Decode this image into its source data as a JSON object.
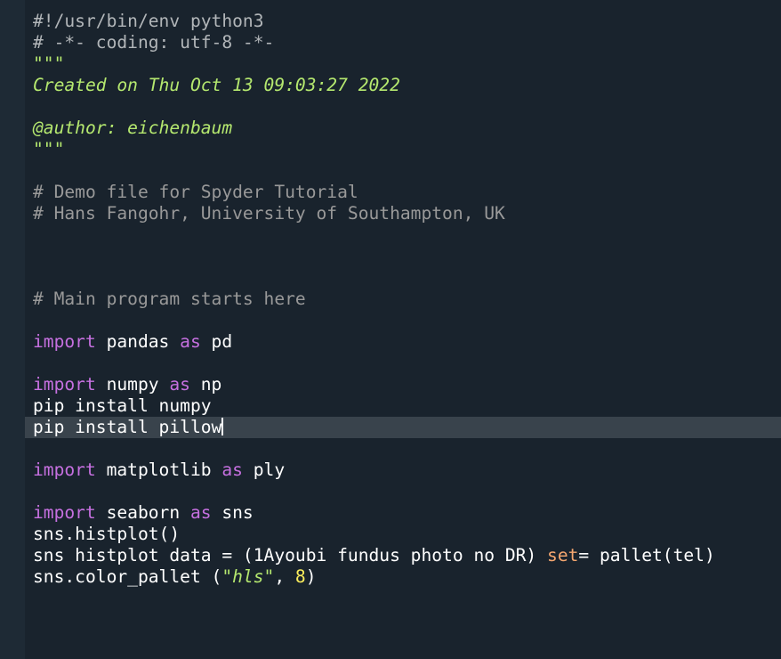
{
  "colors": {
    "background": "#19232d",
    "gutter": "#1e2a35",
    "current_line": "#39434c",
    "keyword": "#c670e0",
    "docstring": "#b5e86f",
    "comment": "#999999",
    "builtin": "#f5a770",
    "number": "#faed5c",
    "text": "#ffffff"
  },
  "editor": {
    "lines": [
      {
        "tokens": [
          {
            "t": "shebang",
            "v": "#!/usr/bin/env python3"
          }
        ]
      },
      {
        "tokens": [
          {
            "t": "shebang",
            "v": "# -*- coding: utf-8 -*-"
          }
        ]
      },
      {
        "tokens": [
          {
            "t": "docstring",
            "v": "\"\"\""
          }
        ]
      },
      {
        "tokens": [
          {
            "t": "docstring",
            "v": "Created on Thu Oct 13 09:03:27 2022"
          }
        ]
      },
      {
        "tokens": []
      },
      {
        "tokens": [
          {
            "t": "docstring",
            "v": "@author: eichenbaum"
          }
        ]
      },
      {
        "tokens": [
          {
            "t": "docstring",
            "v": "\"\"\""
          }
        ]
      },
      {
        "tokens": []
      },
      {
        "tokens": [
          {
            "t": "comment",
            "v": "# Demo file for Spyder Tutorial"
          }
        ]
      },
      {
        "tokens": [
          {
            "t": "comment",
            "v": "# Hans Fangohr, University of Southampton, UK"
          }
        ]
      },
      {
        "tokens": []
      },
      {
        "tokens": []
      },
      {
        "tokens": []
      },
      {
        "tokens": [
          {
            "t": "comment",
            "v": "# Main program starts here"
          }
        ]
      },
      {
        "tokens": []
      },
      {
        "tokens": [
          {
            "t": "kw",
            "v": "import"
          },
          {
            "t": "plain",
            "v": " pandas "
          },
          {
            "t": "kw",
            "v": "as"
          },
          {
            "t": "plain",
            "v": " pd"
          }
        ]
      },
      {
        "tokens": []
      },
      {
        "tokens": [
          {
            "t": "kw",
            "v": "import"
          },
          {
            "t": "plain",
            "v": " numpy "
          },
          {
            "t": "kw",
            "v": "as"
          },
          {
            "t": "plain",
            "v": " np"
          }
        ]
      },
      {
        "tokens": [
          {
            "t": "plain",
            "v": "pip install numpy"
          }
        ]
      },
      {
        "tokens": [
          {
            "t": "plain",
            "v": "pip install pillow"
          }
        ],
        "current": true
      },
      {
        "tokens": []
      },
      {
        "tokens": [
          {
            "t": "kw",
            "v": "import"
          },
          {
            "t": "plain",
            "v": " matplotlib "
          },
          {
            "t": "kw",
            "v": "as"
          },
          {
            "t": "plain",
            "v": " ply"
          }
        ]
      },
      {
        "tokens": []
      },
      {
        "tokens": [
          {
            "t": "kw",
            "v": "import"
          },
          {
            "t": "plain",
            "v": " seaborn "
          },
          {
            "t": "kw",
            "v": "as"
          },
          {
            "t": "plain",
            "v": " sns"
          }
        ]
      },
      {
        "tokens": [
          {
            "t": "plain",
            "v": "sns.histplot()"
          }
        ]
      },
      {
        "tokens": [
          {
            "t": "plain",
            "v": "sns histplot data = (1Ayoubi fundus photo no DR) "
          },
          {
            "t": "builtin",
            "v": "set"
          },
          {
            "t": "plain",
            "v": "= pallet(tel)"
          }
        ]
      },
      {
        "tokens": [
          {
            "t": "plain",
            "v": "sns.color_pallet ("
          },
          {
            "t": "str",
            "v": "\"hls\""
          },
          {
            "t": "plain",
            "v": ", "
          },
          {
            "t": "num",
            "v": "8"
          },
          {
            "t": "plain",
            "v": ")"
          }
        ]
      }
    ]
  }
}
